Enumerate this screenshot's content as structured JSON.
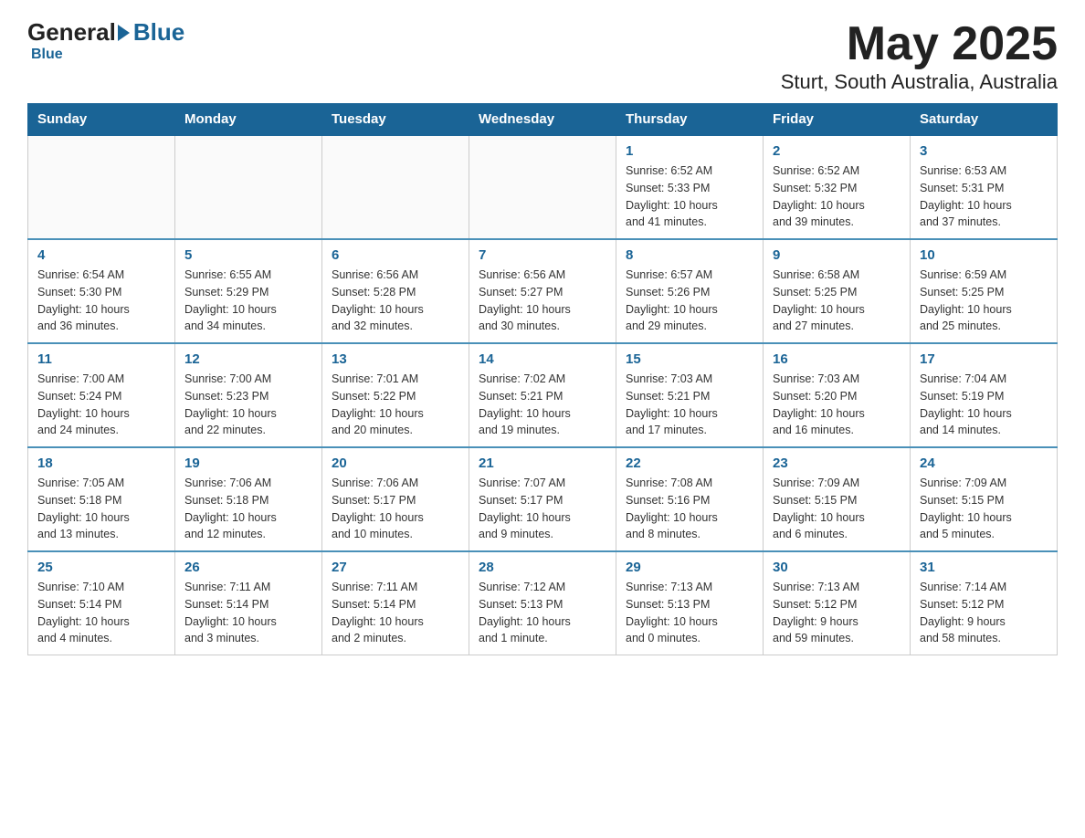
{
  "header": {
    "logo_general": "General",
    "logo_blue": "Blue",
    "title": "May 2025",
    "subtitle": "Sturt, South Australia, Australia"
  },
  "days_of_week": [
    "Sunday",
    "Monday",
    "Tuesday",
    "Wednesday",
    "Thursday",
    "Friday",
    "Saturday"
  ],
  "weeks": [
    [
      {
        "day": "",
        "info": ""
      },
      {
        "day": "",
        "info": ""
      },
      {
        "day": "",
        "info": ""
      },
      {
        "day": "",
        "info": ""
      },
      {
        "day": "1",
        "info": "Sunrise: 6:52 AM\nSunset: 5:33 PM\nDaylight: 10 hours\nand 41 minutes."
      },
      {
        "day": "2",
        "info": "Sunrise: 6:52 AM\nSunset: 5:32 PM\nDaylight: 10 hours\nand 39 minutes."
      },
      {
        "day": "3",
        "info": "Sunrise: 6:53 AM\nSunset: 5:31 PM\nDaylight: 10 hours\nand 37 minutes."
      }
    ],
    [
      {
        "day": "4",
        "info": "Sunrise: 6:54 AM\nSunset: 5:30 PM\nDaylight: 10 hours\nand 36 minutes."
      },
      {
        "day": "5",
        "info": "Sunrise: 6:55 AM\nSunset: 5:29 PM\nDaylight: 10 hours\nand 34 minutes."
      },
      {
        "day": "6",
        "info": "Sunrise: 6:56 AM\nSunset: 5:28 PM\nDaylight: 10 hours\nand 32 minutes."
      },
      {
        "day": "7",
        "info": "Sunrise: 6:56 AM\nSunset: 5:27 PM\nDaylight: 10 hours\nand 30 minutes."
      },
      {
        "day": "8",
        "info": "Sunrise: 6:57 AM\nSunset: 5:26 PM\nDaylight: 10 hours\nand 29 minutes."
      },
      {
        "day": "9",
        "info": "Sunrise: 6:58 AM\nSunset: 5:25 PM\nDaylight: 10 hours\nand 27 minutes."
      },
      {
        "day": "10",
        "info": "Sunrise: 6:59 AM\nSunset: 5:25 PM\nDaylight: 10 hours\nand 25 minutes."
      }
    ],
    [
      {
        "day": "11",
        "info": "Sunrise: 7:00 AM\nSunset: 5:24 PM\nDaylight: 10 hours\nand 24 minutes."
      },
      {
        "day": "12",
        "info": "Sunrise: 7:00 AM\nSunset: 5:23 PM\nDaylight: 10 hours\nand 22 minutes."
      },
      {
        "day": "13",
        "info": "Sunrise: 7:01 AM\nSunset: 5:22 PM\nDaylight: 10 hours\nand 20 minutes."
      },
      {
        "day": "14",
        "info": "Sunrise: 7:02 AM\nSunset: 5:21 PM\nDaylight: 10 hours\nand 19 minutes."
      },
      {
        "day": "15",
        "info": "Sunrise: 7:03 AM\nSunset: 5:21 PM\nDaylight: 10 hours\nand 17 minutes."
      },
      {
        "day": "16",
        "info": "Sunrise: 7:03 AM\nSunset: 5:20 PM\nDaylight: 10 hours\nand 16 minutes."
      },
      {
        "day": "17",
        "info": "Sunrise: 7:04 AM\nSunset: 5:19 PM\nDaylight: 10 hours\nand 14 minutes."
      }
    ],
    [
      {
        "day": "18",
        "info": "Sunrise: 7:05 AM\nSunset: 5:18 PM\nDaylight: 10 hours\nand 13 minutes."
      },
      {
        "day": "19",
        "info": "Sunrise: 7:06 AM\nSunset: 5:18 PM\nDaylight: 10 hours\nand 12 minutes."
      },
      {
        "day": "20",
        "info": "Sunrise: 7:06 AM\nSunset: 5:17 PM\nDaylight: 10 hours\nand 10 minutes."
      },
      {
        "day": "21",
        "info": "Sunrise: 7:07 AM\nSunset: 5:17 PM\nDaylight: 10 hours\nand 9 minutes."
      },
      {
        "day": "22",
        "info": "Sunrise: 7:08 AM\nSunset: 5:16 PM\nDaylight: 10 hours\nand 8 minutes."
      },
      {
        "day": "23",
        "info": "Sunrise: 7:09 AM\nSunset: 5:15 PM\nDaylight: 10 hours\nand 6 minutes."
      },
      {
        "day": "24",
        "info": "Sunrise: 7:09 AM\nSunset: 5:15 PM\nDaylight: 10 hours\nand 5 minutes."
      }
    ],
    [
      {
        "day": "25",
        "info": "Sunrise: 7:10 AM\nSunset: 5:14 PM\nDaylight: 10 hours\nand 4 minutes."
      },
      {
        "day": "26",
        "info": "Sunrise: 7:11 AM\nSunset: 5:14 PM\nDaylight: 10 hours\nand 3 minutes."
      },
      {
        "day": "27",
        "info": "Sunrise: 7:11 AM\nSunset: 5:14 PM\nDaylight: 10 hours\nand 2 minutes."
      },
      {
        "day": "28",
        "info": "Sunrise: 7:12 AM\nSunset: 5:13 PM\nDaylight: 10 hours\nand 1 minute."
      },
      {
        "day": "29",
        "info": "Sunrise: 7:13 AM\nSunset: 5:13 PM\nDaylight: 10 hours\nand 0 minutes."
      },
      {
        "day": "30",
        "info": "Sunrise: 7:13 AM\nSunset: 5:12 PM\nDaylight: 9 hours\nand 59 minutes."
      },
      {
        "day": "31",
        "info": "Sunrise: 7:14 AM\nSunset: 5:12 PM\nDaylight: 9 hours\nand 58 minutes."
      }
    ]
  ]
}
